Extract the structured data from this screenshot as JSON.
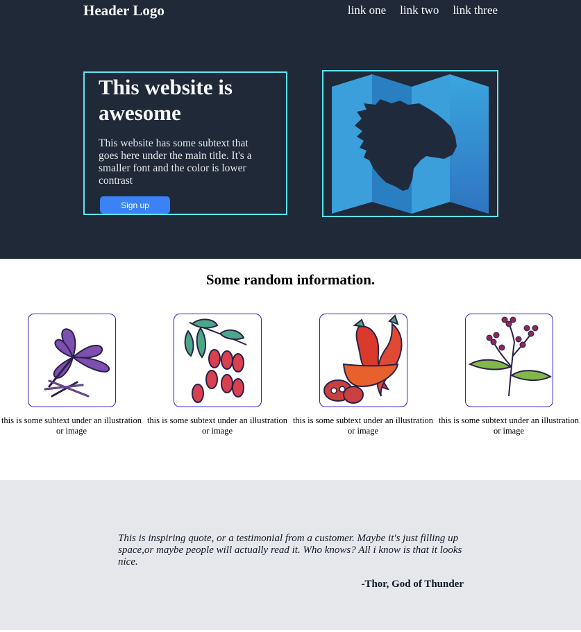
{
  "header": {
    "logo": "Header Logo",
    "nav": [
      "link one",
      "link two",
      "link three"
    ]
  },
  "hero": {
    "title": "This website is awesome",
    "subtext": "This website has some subtext that goes here under the main title. It's a smaller font and the color is lower contrast",
    "signup_label": "Sign up",
    "image_icon": "lion-map-icon"
  },
  "info": {
    "title": "Some random information.",
    "cards": [
      {
        "icon": "saffron-flower-icon",
        "caption": "this is some subtext under an illustration or image"
      },
      {
        "icon": "berry-branch-icon",
        "caption": "this is some subtext under an illustration or image"
      },
      {
        "icon": "chili-pepper-icon",
        "caption": "this is some subtext under an illustration or image"
      },
      {
        "icon": "flowering-plant-icon",
        "caption": "this is some subtext under an illustration or image"
      }
    ]
  },
  "quote": {
    "text": "This is inspiring quote, or a testimonial from a customer. Maybe it's just filling up space,or maybe people will actually read it. Who knows? All i know is that it looks nice.",
    "author": "-Thor, God of Thunder"
  },
  "colors": {
    "hero_bg": "#1f2937",
    "accent_border": "#5de6f2",
    "button": "#3b82f6",
    "card_border": "#2f1bd1",
    "quote_bg": "#e5e7eb"
  }
}
